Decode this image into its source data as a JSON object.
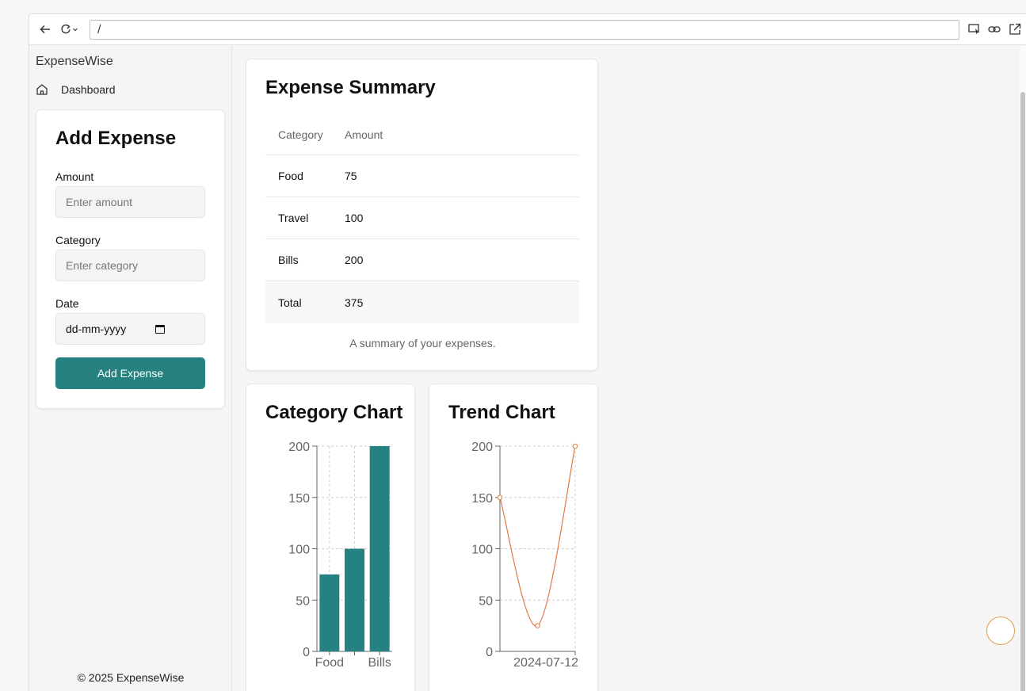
{
  "browser": {
    "url": "/"
  },
  "sidebar": {
    "brand": "ExpenseWise",
    "nav": [
      {
        "label": "Dashboard",
        "icon": "home-icon"
      }
    ],
    "footer": "© 2025 ExpenseWise"
  },
  "form": {
    "title": "Add Expense",
    "amount_label": "Amount",
    "amount_placeholder": "Enter amount",
    "category_label": "Category",
    "category_placeholder": "Enter category",
    "date_label": "Date",
    "date_placeholder": "dd-mm-yyyy",
    "submit_label": "Add Expense"
  },
  "summary": {
    "title": "Expense Summary",
    "headers": [
      "Category",
      "Amount"
    ],
    "rows": [
      {
        "category": "Food",
        "amount": "75"
      },
      {
        "category": "Travel",
        "amount": "100"
      },
      {
        "category": "Bills",
        "amount": "200"
      }
    ],
    "total": {
      "label": "Total",
      "amount": "375"
    },
    "caption": "A summary of your expenses."
  },
  "colors": {
    "accent": "#268280",
    "trend_line": "#e07b45"
  },
  "chart_data": [
    {
      "type": "bar",
      "title": "Category Chart",
      "categories": [
        "Food",
        "Travel",
        "Bills"
      ],
      "visible_tick_labels": [
        "Food",
        "Bills"
      ],
      "values": [
        75,
        100,
        200
      ],
      "ylim": [
        0,
        200
      ],
      "yticks": [
        0,
        50,
        100,
        150,
        200
      ],
      "grid": true
    },
    {
      "type": "line",
      "title": "Trend Chart",
      "x": [
        "",
        "",
        "2024-07-12"
      ],
      "values": [
        150,
        25,
        200
      ],
      "ylim": [
        0,
        200
      ],
      "yticks": [
        0,
        50,
        100,
        150,
        200
      ],
      "grid": true
    }
  ]
}
